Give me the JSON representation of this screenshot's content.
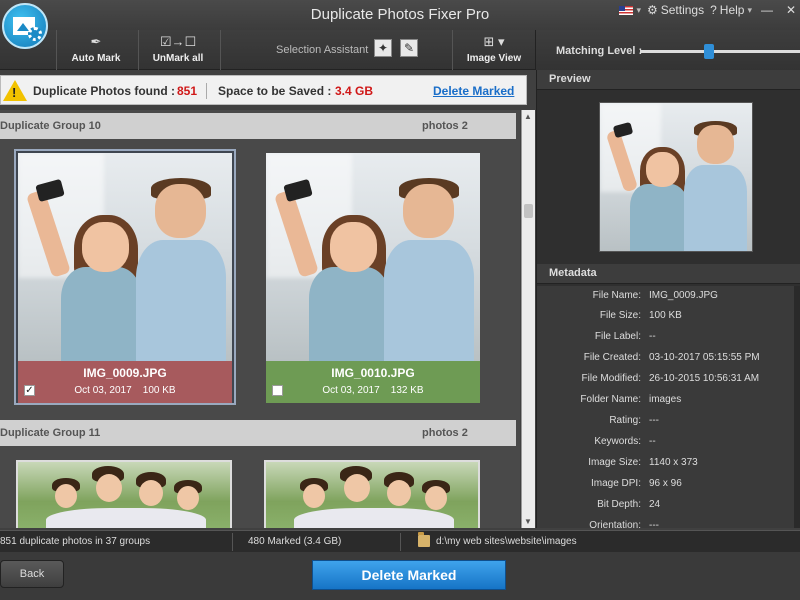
{
  "window": {
    "title": "Duplicate Photos Fixer Pro",
    "settings_label": "Settings",
    "help_label": "Help",
    "minimize": "—",
    "close": "✕"
  },
  "toolbar": {
    "auto_mark": "Auto Mark",
    "unmark_all": "UnMark all",
    "selection_assistant": "Selection Assistant",
    "image_view": "Image View",
    "matching_level": "Matching Level :",
    "matching_level_value_fraction": 0.43
  },
  "infobar": {
    "found_label": "Duplicate Photos found :",
    "found_value": "851",
    "space_label": "Space to be Saved :",
    "space_value": "3.4 GB",
    "delete_link": "Delete Marked"
  },
  "groups": [
    {
      "name": "Duplicate Group 10",
      "count": "photos 2",
      "items": [
        {
          "file": "IMG_0009.JPG",
          "date": "Oct 03, 2017",
          "size": "100 KB",
          "checked": true,
          "check_glyph": "✓"
        },
        {
          "file": "IMG_0010.JPG",
          "date": "Oct 03, 2017",
          "size": "132 KB",
          "checked": false,
          "check_glyph": ""
        }
      ]
    },
    {
      "name": "Duplicate Group 11",
      "count": "photos 2"
    }
  ],
  "right_panel": {
    "preview_title": "Preview",
    "metadata_title": "Metadata",
    "metadata": [
      {
        "key": "File Name:",
        "value": "IMG_0009.JPG"
      },
      {
        "key": "File Size:",
        "value": "100 KB"
      },
      {
        "key": "File Label:",
        "value": "--"
      },
      {
        "key": "File Created:",
        "value": "03-10-2017 05:15:55 PM"
      },
      {
        "key": "File Modified:",
        "value": "26-10-2015 10:56:31 AM"
      },
      {
        "key": "Folder Name:",
        "value": "images"
      },
      {
        "key": "Rating:",
        "value": "---"
      },
      {
        "key": "Keywords:",
        "value": "--"
      },
      {
        "key": "Image Size:",
        "value": "1140 x 373"
      },
      {
        "key": "Image DPI:",
        "value": "96 x 96"
      },
      {
        "key": "Bit Depth:",
        "value": "24"
      },
      {
        "key": "Orientation:",
        "value": "---"
      }
    ]
  },
  "status": {
    "summary": "851 duplicate photos in 37 groups",
    "marked": "480 Marked (3.4 GB)",
    "path": "d:\\my web sites\\website\\images"
  },
  "buttons": {
    "back": "Back",
    "delete_marked": "Delete Marked"
  },
  "colors": {
    "accent": "#1674c6",
    "marked_caption": "#a75a5d",
    "unmarked_caption": "#6e9b54",
    "highlight_red": "#d01818"
  }
}
